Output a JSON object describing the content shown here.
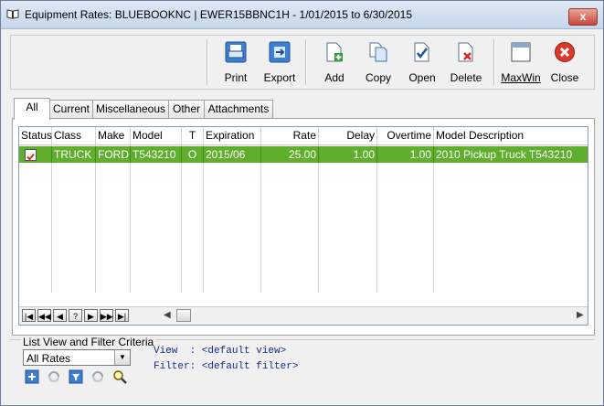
{
  "window": {
    "title": "Equipment Rates: BLUEBOOKNC | EWER15BBNC1H -  1/01/2015 to  6/30/2015",
    "close_label": "x"
  },
  "toolbar": {
    "buttons": [
      {
        "label": "Print",
        "icon": "printer-icon"
      },
      {
        "label": "Export",
        "icon": "export-icon"
      },
      {
        "label": "Add",
        "icon": "add-document-icon"
      },
      {
        "label": "Copy",
        "icon": "copy-icon"
      },
      {
        "label": "Open",
        "icon": "open-document-icon"
      },
      {
        "label": "Delete",
        "icon": "delete-document-icon"
      },
      {
        "label": "MaxWin",
        "icon": "maximize-window-icon"
      },
      {
        "label": "Close",
        "icon": "close-circle-icon"
      }
    ]
  },
  "tabs": [
    "All",
    "Current",
    "Miscellaneous",
    "Other",
    "Attachments"
  ],
  "grid": {
    "columns": [
      "Status",
      "Class",
      "Make",
      "Model",
      "T",
      "Expiration",
      "Rate",
      "Delay",
      "Overtime",
      "Model Description"
    ],
    "rows": [
      {
        "status_checked": true,
        "class": "TRUCK",
        "make": "FORD",
        "model": "T543210",
        "t": "O",
        "expiration": "2015/06",
        "rate": "25.00",
        "delay": "1.00",
        "overtime": "1.00",
        "description": "2010 Pickup Truck T543210"
      }
    ]
  },
  "navigator": {
    "buttons": [
      "|◀",
      "◀◀",
      "◀",
      "?",
      "▶",
      "▶▶",
      "▶|"
    ]
  },
  "filter": {
    "section_label": "List View and Filter Criteria",
    "selected_view": "All Rates",
    "view_text": "View  : <default view>",
    "filter_text": "Filter: <default filter>"
  },
  "colors": {
    "selected_row": "#5fae2e",
    "criteria_text": "#1a2a8a"
  }
}
